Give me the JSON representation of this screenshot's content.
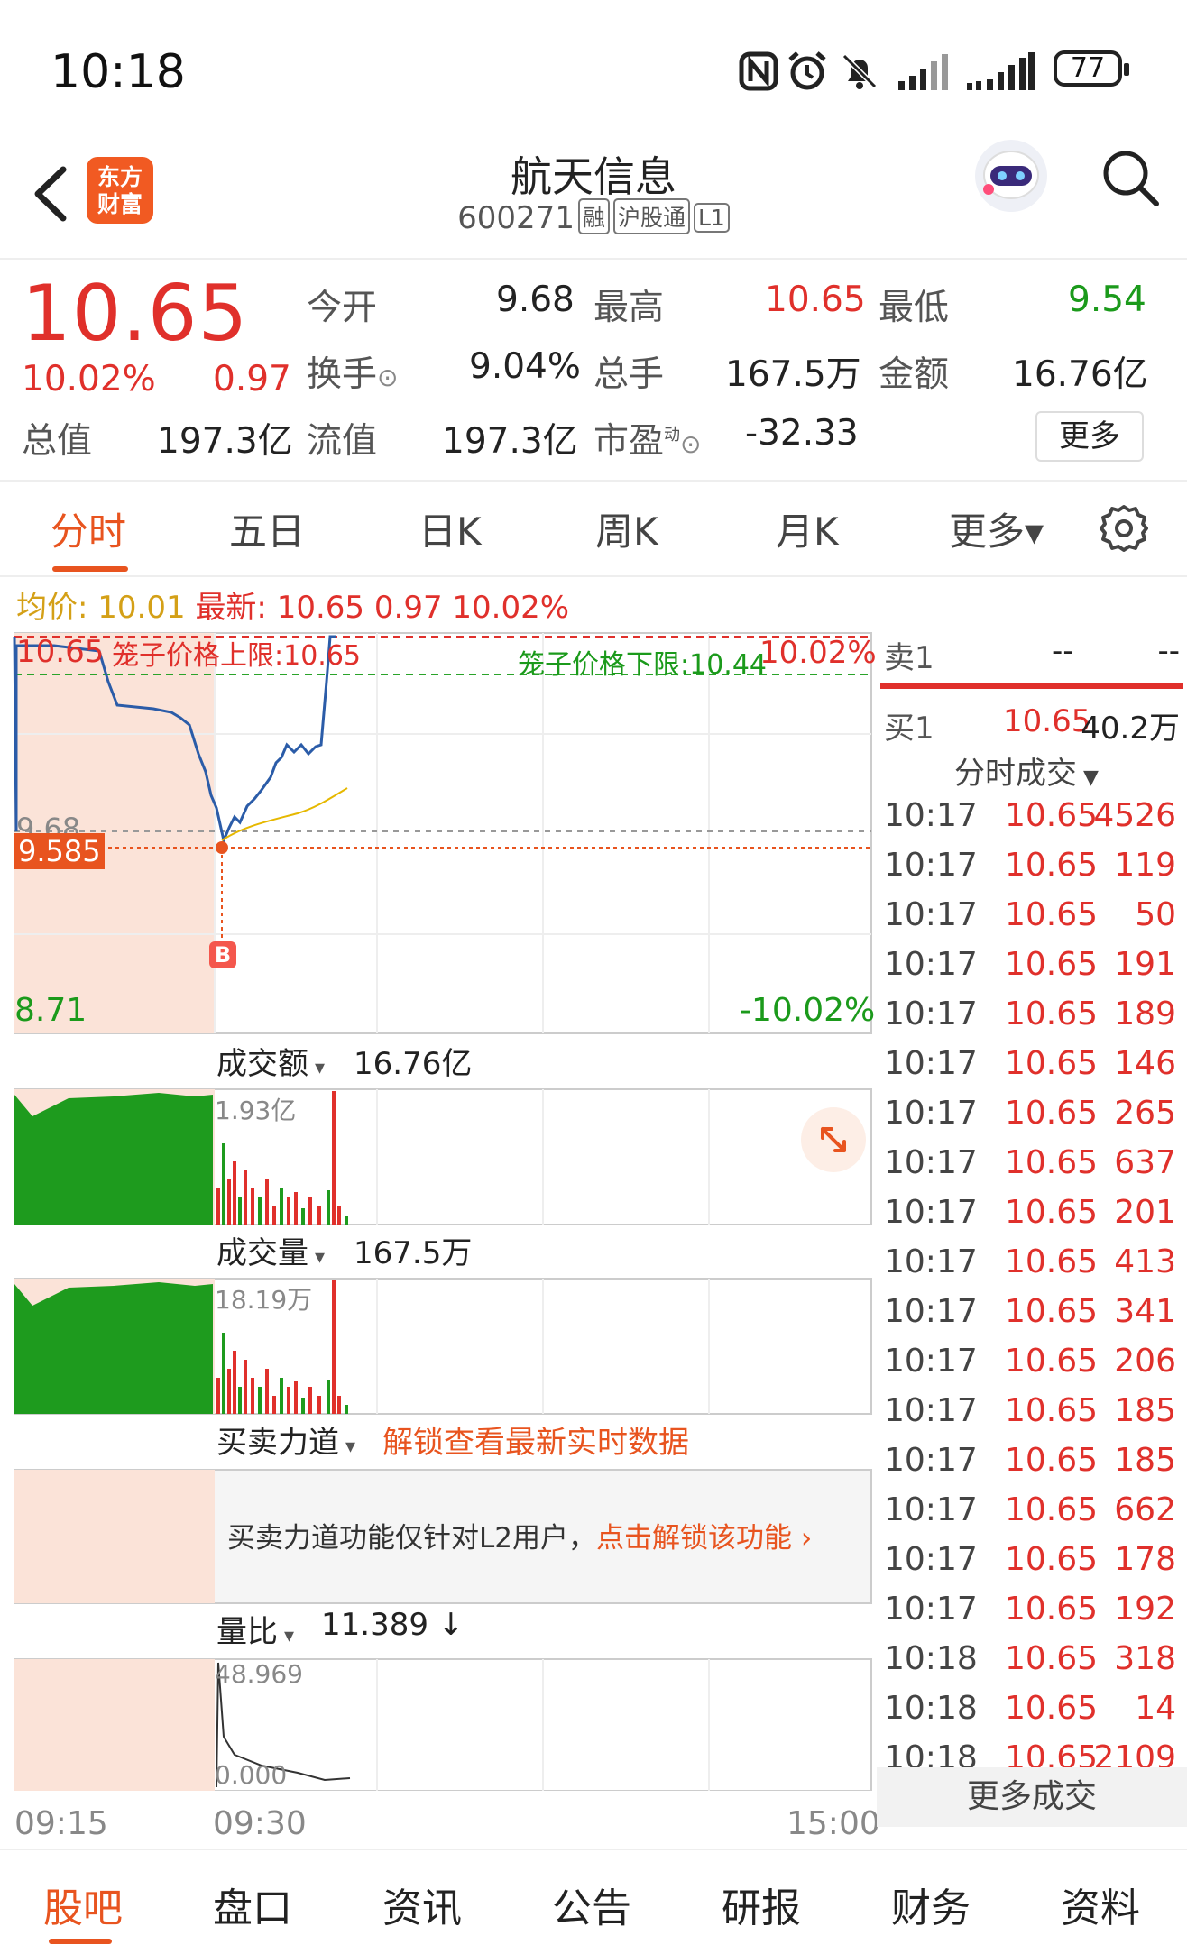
{
  "status": {
    "time": "10:18",
    "battery": "77"
  },
  "header": {
    "brand": "东方财富",
    "name": "航天信息",
    "code": "600271",
    "tags": [
      "融",
      "沪股通",
      "L1"
    ]
  },
  "quote": {
    "price": "10.65",
    "change_pct": "10.02%",
    "change": "0.97",
    "fields": {
      "open_label": "今开",
      "open": "9.68",
      "high_label": "最高",
      "high": "10.65",
      "low_label": "最低",
      "low": "9.54",
      "turnover_label": "换手",
      "turnover": "9.04%",
      "volume_label": "总手",
      "volume": "167.5万",
      "amount_label": "金额",
      "amount": "16.76亿",
      "mktcap_label": "总值",
      "mktcap": "197.3亿",
      "float_label": "流值",
      "float": "197.3亿",
      "pe_label": "市盈",
      "pe_sup": "动",
      "pe": "-32.33"
    },
    "more": "更多"
  },
  "tabs": [
    "分时",
    "五日",
    "日K",
    "周K",
    "月K",
    "更多▾"
  ],
  "infoline": {
    "avg_label": "均价:",
    "avg": "10.01",
    "latest_label": "最新:",
    "latest": "10.65",
    "latest_change": "0.97",
    "latest_pct": "10.02%"
  },
  "chart": {
    "upper_limit_label": "笼子价格上限:10.65",
    "lower_limit_label": "笼子价格下限:10.44",
    "top_price": "10.65",
    "top_pct": "10.02%",
    "mid_price": "9.68",
    "cursor_price": "9.585",
    "bottom_price": "8.71",
    "bottom_pct": "-10.02%",
    "buy_marker": "B",
    "amount_label": "成交额",
    "amount_total": "16.76亿",
    "amount_max": "1.93亿",
    "volume_label": "成交量",
    "volume_total": "167.5万",
    "volume_max": "18.19万",
    "force_label": "买卖力道",
    "force_unlock": "解锁查看最新实时数据",
    "force_note": "买卖力道功能仅针对L2用户，",
    "force_note_link": "点击解锁该功能",
    "ratio_label": "量比",
    "ratio_value": "11.389",
    "ratio_max": "48.969",
    "ratio_min": "0.000",
    "times": [
      "09:15",
      "09:30",
      "15:00"
    ]
  },
  "book": {
    "sell_label": "卖1",
    "sell_price": "--",
    "sell_vol": "--",
    "buy_label": "买1",
    "buy_price": "10.65",
    "buy_vol": "40.2万",
    "trades_label": "分时成交",
    "trades": [
      {
        "t": "10:17",
        "p": "10.65",
        "v": "4526"
      },
      {
        "t": "10:17",
        "p": "10.65",
        "v": "119"
      },
      {
        "t": "10:17",
        "p": "10.65",
        "v": "50"
      },
      {
        "t": "10:17",
        "p": "10.65",
        "v": "191"
      },
      {
        "t": "10:17",
        "p": "10.65",
        "v": "189"
      },
      {
        "t": "10:17",
        "p": "10.65",
        "v": "146"
      },
      {
        "t": "10:17",
        "p": "10.65",
        "v": "265"
      },
      {
        "t": "10:17",
        "p": "10.65",
        "v": "637"
      },
      {
        "t": "10:17",
        "p": "10.65",
        "v": "201"
      },
      {
        "t": "10:17",
        "p": "10.65",
        "v": "413"
      },
      {
        "t": "10:17",
        "p": "10.65",
        "v": "341"
      },
      {
        "t": "10:17",
        "p": "10.65",
        "v": "206"
      },
      {
        "t": "10:17",
        "p": "10.65",
        "v": "185"
      },
      {
        "t": "10:17",
        "p": "10.65",
        "v": "185"
      },
      {
        "t": "10:17",
        "p": "10.65",
        "v": "662"
      },
      {
        "t": "10:17",
        "p": "10.65",
        "v": "178"
      },
      {
        "t": "10:17",
        "p": "10.65",
        "v": "192"
      },
      {
        "t": "10:18",
        "p": "10.65",
        "v": "318"
      },
      {
        "t": "10:18",
        "p": "10.65",
        "v": "14"
      },
      {
        "t": "10:18",
        "p": "10.65",
        "v": "2109"
      }
    ],
    "more_trades": "更多成交"
  },
  "bottomnav": [
    "股吧",
    "盘口",
    "资讯",
    "公告",
    "研报",
    "财务",
    "资料"
  ]
}
